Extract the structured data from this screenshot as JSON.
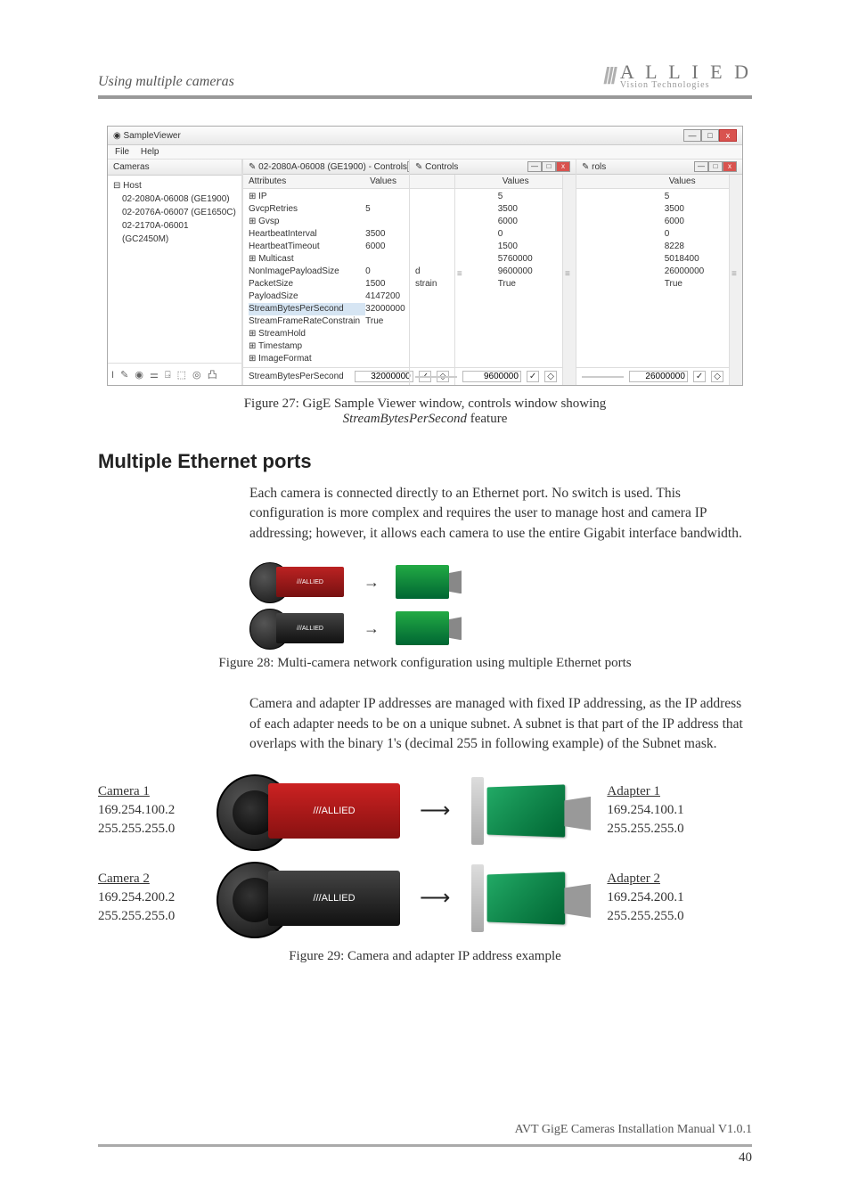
{
  "header": {
    "section": "Using multiple cameras",
    "logo_main": "A L L I E D",
    "logo_sub": "Vision Technologies"
  },
  "screenshot": {
    "window_title": "SampleViewer",
    "menu": {
      "file": "File",
      "help": "Help"
    },
    "cameras_label": "Cameras",
    "tree": {
      "root": "Host",
      "items": [
        "02-2080A-06008 (GE1900)",
        "02-2076A-06007 (GE1650C)",
        "02-2170A-06001 (GC2450M)"
      ]
    },
    "toolbar_glyphs": "I ✎ ◉ ⚌ ⍈ ⬚ ◎ 凸",
    "panes": [
      {
        "title": "02-2080A-06008 (GE1900) - Controls",
        "footer_value": "32000000"
      },
      {
        "title": "Controls",
        "footer_value": "9600000"
      },
      {
        "title": "rols",
        "footer_value": "26000000"
      }
    ],
    "col_attr": "Attributes",
    "col_val": "Values",
    "rows": [
      {
        "label": "⊞ IP",
        "v": [
          "",
          "",
          ""
        ]
      },
      {
        "label": "  GvcpRetries",
        "v": [
          "5",
          "5",
          "5"
        ]
      },
      {
        "label": "⊞ Gvsp",
        "v": [
          "",
          "",
          ""
        ]
      },
      {
        "label": "  HeartbeatInterval",
        "v": [
          "3500",
          "3500",
          "3500"
        ]
      },
      {
        "label": "  HeartbeatTimeout",
        "v": [
          "6000",
          "6000",
          "6000"
        ]
      },
      {
        "label": "⊞ Multicast",
        "v": [
          "",
          "",
          ""
        ]
      },
      {
        "label": "  NonImagePayloadSize",
        "v": [
          "0",
          "0",
          "0"
        ]
      },
      {
        "label": "  PacketSize",
        "v": [
          "1500",
          "1500",
          "8228"
        ]
      },
      {
        "label": "  PayloadSize",
        "v": [
          "4147200",
          "5760000",
          "5018400"
        ]
      },
      {
        "label": "  StreamBytesPerSecond",
        "highlight": true,
        "v": [
          "32000000",
          "9600000",
          "26000000"
        ]
      },
      {
        "label": "  StreamFrameRateConstrain",
        "v": [
          "True",
          "True",
          "True"
        ]
      },
      {
        "label": "⊞ StreamHold",
        "v": [
          "",
          "",
          ""
        ]
      },
      {
        "label": "⊞ Timestamp",
        "v": [
          "",
          "",
          ""
        ]
      },
      {
        "label": "⊞ ImageFormat",
        "v": [
          "",
          "",
          ""
        ]
      }
    ],
    "footer_label": "StreamBytesPerSecond"
  },
  "fig27": {
    "prefix": "Figure 27: GigE Sample Viewer window, controls window showing ",
    "italic": "StreamBytesPerSecond",
    "suffix": " feature"
  },
  "section_heading": "Multiple Ethernet ports",
  "para1": "Each camera is connected directly to an Ethernet port. No switch is used. This configuration is more complex and requires the user to manage host and camera IP addressing; however, it allows each camera to use the entire Gigabit interface bandwidth.",
  "fig28_caption": "Figure 28: Multi-camera network configuration using multiple Ethernet ports",
  "para2": "Camera and adapter IP addresses are managed with fixed IP addressing, as the IP address of each adapter needs to be on a unique subnet.   A subnet is that part of the IP address that overlaps with the binary 1's (decimal 255 in following example) of the Subnet mask.",
  "fig29": {
    "camera1": {
      "label": "Camera 1",
      "ip": "169.254.100.2",
      "mask": "255.255.255.0"
    },
    "camera2": {
      "label": "Camera 2",
      "ip": "169.254.200.2",
      "mask": "255.255.255.0"
    },
    "adapter1": {
      "label": "Adapter 1",
      "ip": "169.254.100.1",
      "mask": "255.255.255.0"
    },
    "adapter2": {
      "label": "Adapter 2",
      "ip": "169.254.200.1",
      "mask": "255.255.255.0"
    },
    "cam_logo": "///ALLIED"
  },
  "fig29_caption": "Figure 29: Camera and adapter IP address example",
  "footer": {
    "manual": "AVT GigE Cameras Installation Manual V1.0.1",
    "page": "40"
  }
}
